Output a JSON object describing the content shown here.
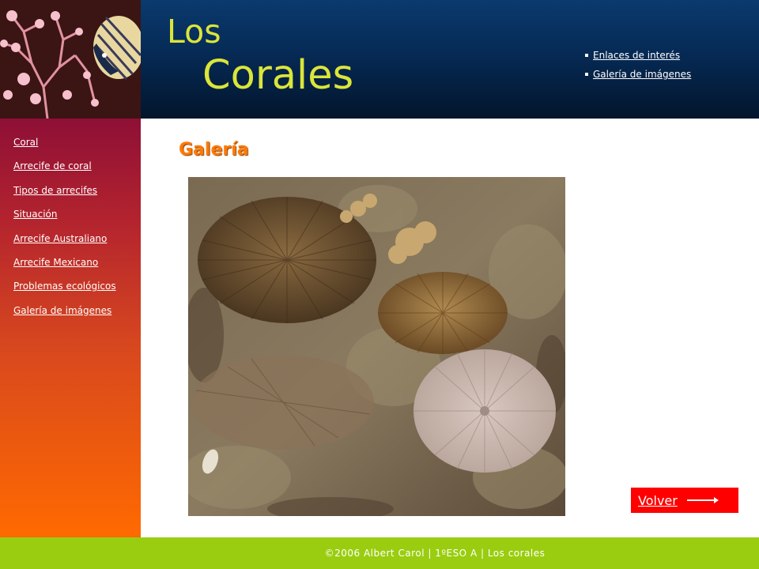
{
  "header": {
    "title_line1": "Los",
    "title_line2": "Corales",
    "links": [
      {
        "label": "Enlaces de interés"
      },
      {
        "label": " Galería de imágenes"
      }
    ]
  },
  "sidebar": {
    "items": [
      {
        "label": "Coral"
      },
      {
        "label": "Arrecife de coral"
      },
      {
        "label": "Tipos de arrecifes"
      },
      {
        "label": "Situación"
      },
      {
        "label": "Arrecife Australiano"
      },
      {
        "label": "Arrecife Mexicano"
      },
      {
        "label": "Problemas ecológicos"
      },
      {
        "label": "Galería de imágenes"
      }
    ]
  },
  "main": {
    "title": "Galería",
    "photo_icon": "coral-photo",
    "volver_label": "Volver"
  },
  "footer": {
    "text": "©2006 Albert Carol  | 1ºESO A | Los corales"
  },
  "colors": {
    "title_yellow": "#dbe53a",
    "heading_orange": "#ff7a00",
    "volver_red": "#ff0000",
    "footer_green": "#9acd10"
  }
}
